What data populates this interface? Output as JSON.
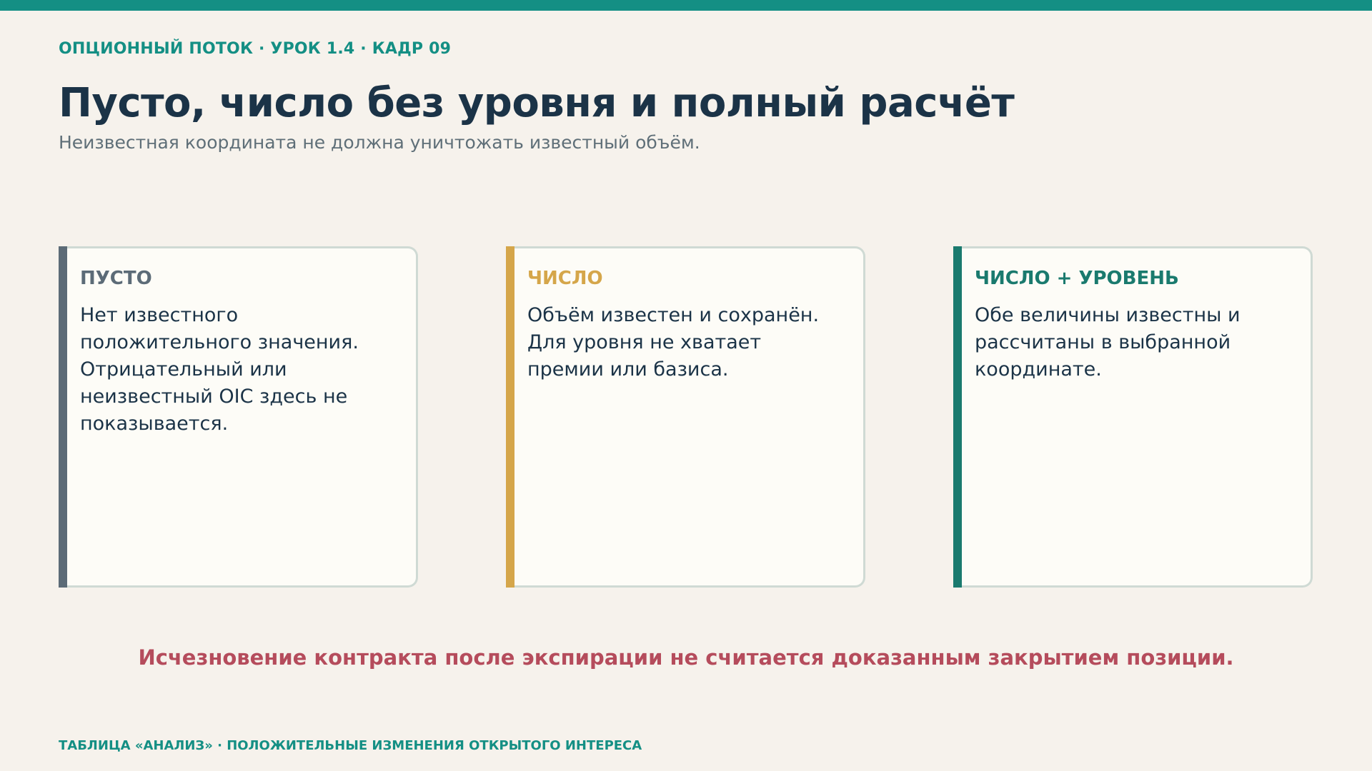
{
  "header": {
    "eyebrow": "ОПЦИОННЫЙ ПОТОК · УРОК 1.4 · КАДР 09",
    "title": "Пусто, число без уровня и полный расчёт",
    "subtitle": "Неизвестная координата не должна уничтожать известный объём."
  },
  "cards": [
    {
      "label": "ПУСТО",
      "text": "Нет известного положительного значения. Отрицательный или неизвестный OIC здесь не показывается.",
      "color": "#5c6b77"
    },
    {
      "label": "ЧИСЛО",
      "text": "Объём известен и сохранён. Для уровня не хватает премии или базиса.",
      "color": "#d5a64a"
    },
    {
      "label": "ЧИСЛО + УРОВЕНЬ",
      "text": "Обе величины известны и рассчитаны в выбранной координате.",
      "color": "#1a7a6e"
    }
  ],
  "warning": "Исчезновение контракта после экспирации не считается доказанным закрытием позиции.",
  "footer": "ТАБЛИЦА «АНАЛИЗ» · ПОЛОЖИТЕЛЬНЫЕ ИЗМЕНЕНИЯ ОТКРЫТОГО ИНТЕРЕСА",
  "colors": {
    "accent": "#148f84",
    "title": "#1b3347",
    "warning": "#b54c5c",
    "background": "#f6f2ec"
  }
}
